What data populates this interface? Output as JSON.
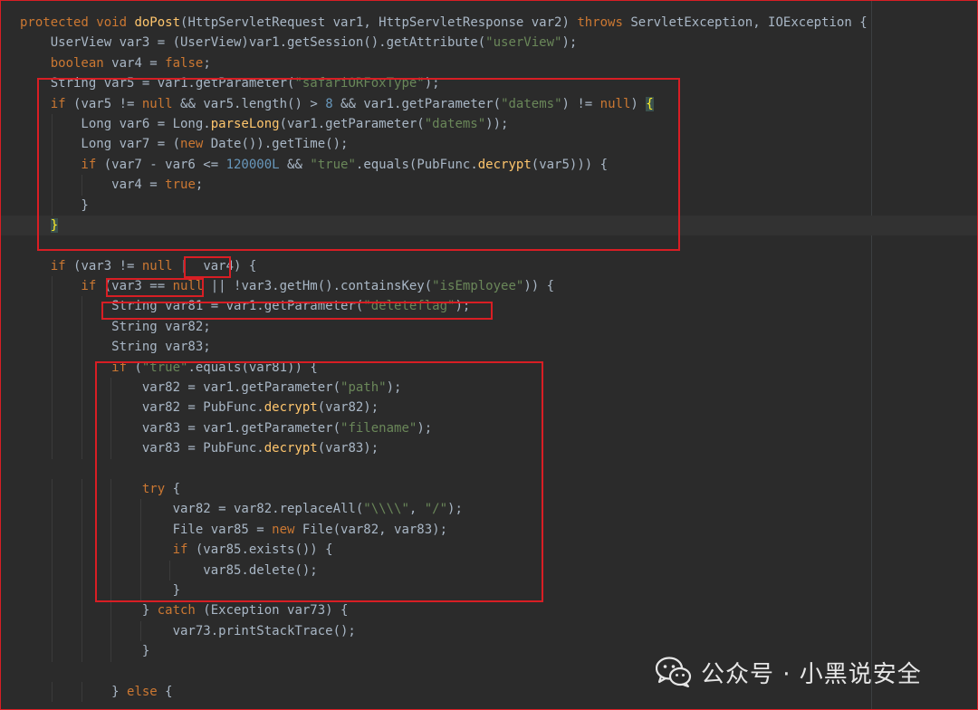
{
  "code_lines": [
    [
      [
        "kw",
        "protected "
      ],
      [
        "kw",
        "void "
      ],
      [
        "fn",
        "doPost"
      ],
      [
        "",
        "(HttpServletRequest var1, HttpServletResponse var2) "
      ],
      [
        "kw",
        "throws "
      ],
      [
        "",
        "ServletException, IOException {"
      ]
    ],
    [
      [
        "",
        "    UserView var3 = (UserView)var1.getSession().getAttribute("
      ],
      [
        "str",
        "\"userView\""
      ],
      [
        "",
        ");"
      ]
    ],
    [
      [
        "kw",
        "    boolean "
      ],
      [
        "",
        "var4 = "
      ],
      [
        "kw",
        "false"
      ],
      [
        "",
        ";"
      ]
    ],
    [
      [
        "",
        "    String var5 = var1.getParameter("
      ],
      [
        "str",
        "\"safariORFoxType\""
      ],
      [
        "",
        ");"
      ]
    ],
    [
      [
        "kw",
        "    if "
      ],
      [
        "",
        "(var5 != "
      ],
      [
        "kw",
        "null "
      ],
      [
        "",
        "&& var5.length() > "
      ],
      [
        "num",
        "8 "
      ],
      [
        "",
        "&& var1.getParameter("
      ],
      [
        "str",
        "\"datems\""
      ],
      [
        "",
        ") != "
      ],
      [
        "kw",
        "null"
      ],
      [
        "",
        ") "
      ],
      [
        "hl",
        "{"
      ]
    ],
    [
      [
        "",
        "        Long var6 = Long."
      ],
      [
        "fn",
        "parseLong"
      ],
      [
        "",
        "(var1.getParameter("
      ],
      [
        "str",
        "\"datems\""
      ],
      [
        "",
        "));"
      ]
    ],
    [
      [
        "",
        "        Long var7 = ("
      ],
      [
        "kw",
        "new "
      ],
      [
        "",
        "Date()).getTime();"
      ]
    ],
    [
      [
        "kw",
        "        if "
      ],
      [
        "",
        "(var7 - var6 <= "
      ],
      [
        "num",
        "120000L "
      ],
      [
        "",
        "&& "
      ],
      [
        "str",
        "\"true\""
      ],
      [
        "",
        ".equals(PubFunc."
      ],
      [
        "fn",
        "decrypt"
      ],
      [
        "",
        "(var5))) {"
      ]
    ],
    [
      [
        "",
        "            var4 = "
      ],
      [
        "kw",
        "true"
      ],
      [
        "",
        ";"
      ]
    ],
    [
      [
        "",
        "        }"
      ]
    ],
    [
      [
        "hl",
        "    }"
      ]
    ],
    [
      [
        "",
        ""
      ]
    ],
    [
      [
        "kw",
        "    if "
      ],
      [
        "",
        "(var3 != "
      ],
      [
        "kw",
        "null "
      ],
      [
        "",
        "|  var4) {"
      ]
    ],
    [
      [
        "kw",
        "        if "
      ],
      [
        "",
        "(var3 == "
      ],
      [
        "kw",
        "null "
      ],
      [
        "",
        "|| !var3.getHm().containsKey("
      ],
      [
        "str",
        "\"isEmployee\""
      ],
      [
        "",
        "))"
      ],
      [
        "",
        " {"
      ]
    ],
    [
      [
        "",
        "            String var81 = var1.getParameter("
      ],
      [
        "str",
        "\"deleteflag\""
      ],
      [
        "",
        ");"
      ]
    ],
    [
      [
        "",
        "            String var82;"
      ]
    ],
    [
      [
        "",
        "            String var83;"
      ]
    ],
    [
      [
        "kw",
        "            if "
      ],
      [
        "",
        "("
      ],
      [
        "str",
        "\"true\""
      ],
      [
        "",
        ".equals(var81)) {"
      ]
    ],
    [
      [
        "",
        "                var82 = var1.getParameter("
      ],
      [
        "str",
        "\"path\""
      ],
      [
        "",
        ");"
      ]
    ],
    [
      [
        "",
        "                var82 = PubFunc."
      ],
      [
        "fn",
        "decrypt"
      ],
      [
        "",
        "(var82);"
      ]
    ],
    [
      [
        "",
        "                var83 = var1.getParameter("
      ],
      [
        "str",
        "\"filename\""
      ],
      [
        "",
        ");"
      ]
    ],
    [
      [
        "",
        "                var83 = PubFunc."
      ],
      [
        "fn",
        "decrypt"
      ],
      [
        "",
        "(var83);"
      ]
    ],
    [
      [
        "",
        ""
      ]
    ],
    [
      [
        "kw",
        "                try "
      ],
      [
        "",
        "{"
      ]
    ],
    [
      [
        "",
        "                    var82 = var82.replaceAll("
      ],
      [
        "str",
        "\"\\\\\\\\\""
      ],
      [
        "",
        ", "
      ],
      [
        "str",
        "\"/\""
      ],
      [
        "",
        ");"
      ]
    ],
    [
      [
        "",
        "                    File var85 = "
      ],
      [
        "kw",
        "new "
      ],
      [
        "",
        "File(var82, var83);"
      ]
    ],
    [
      [
        "kw",
        "                    if "
      ],
      [
        "",
        "(var85.exists()) {"
      ]
    ],
    [
      [
        "",
        "                        var85.delete();"
      ]
    ],
    [
      [
        "",
        "                    }"
      ]
    ],
    [
      [
        "",
        "                } "
      ],
      [
        "kw",
        "catch "
      ],
      [
        "",
        "(Exception var73) {"
      ]
    ],
    [
      [
        "",
        "                    var73.printStackTrace();"
      ]
    ],
    [
      [
        "",
        "                }"
      ]
    ],
    [
      [
        "",
        ""
      ]
    ],
    [
      [
        "",
        "            } "
      ],
      [
        "kw",
        "else "
      ],
      [
        "",
        "{"
      ]
    ]
  ],
  "current_line_index": 10,
  "watermark": {
    "icon": "wechat-icon",
    "text": "公众号 · 小黑说安全"
  },
  "colors": {
    "background": "#2b2b2b",
    "keyword": "#cc7832",
    "method": "#ffc66d",
    "string": "#6a8759",
    "number": "#6897bb",
    "plain": "#a9b7c6",
    "annotation_box": "#d81e24"
  }
}
